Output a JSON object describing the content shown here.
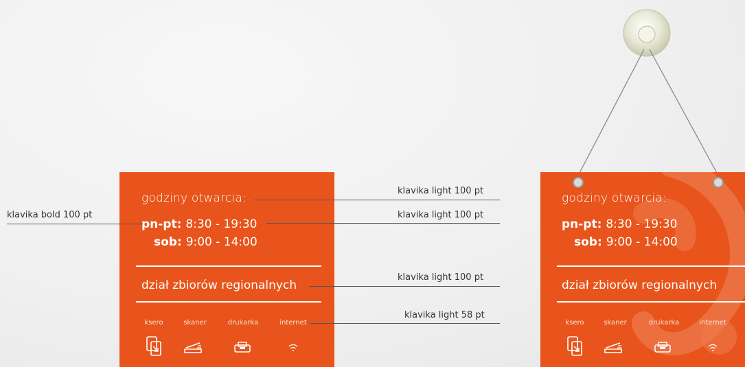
{
  "sign": {
    "hours_title": "godziny otwarcia:",
    "weekday_label": "pn-pt:",
    "weekday_hours": "8:30 - 19:30",
    "saturday_label": "sob:",
    "saturday_hours": "9:00 - 14:00",
    "department": "dział zbiorów regionalnych",
    "services": [
      {
        "label": "ksero",
        "icon": "copier-icon"
      },
      {
        "label": "skaner",
        "icon": "scanner-icon"
      },
      {
        "label": "drukarka",
        "icon": "printer-icon"
      },
      {
        "label": "internet",
        "icon": "wifi-icon"
      }
    ]
  },
  "annotations": {
    "title_font": "klavika light 100 pt",
    "bold_font": "klavika bold 100 pt",
    "hours_font": "klavika light 100 pt",
    "dept_font": "klavika light 100 pt",
    "small_font": "klavika light 58 pt"
  },
  "colors": {
    "sign_orange": "#e8541b",
    "text": "#ffffff"
  }
}
